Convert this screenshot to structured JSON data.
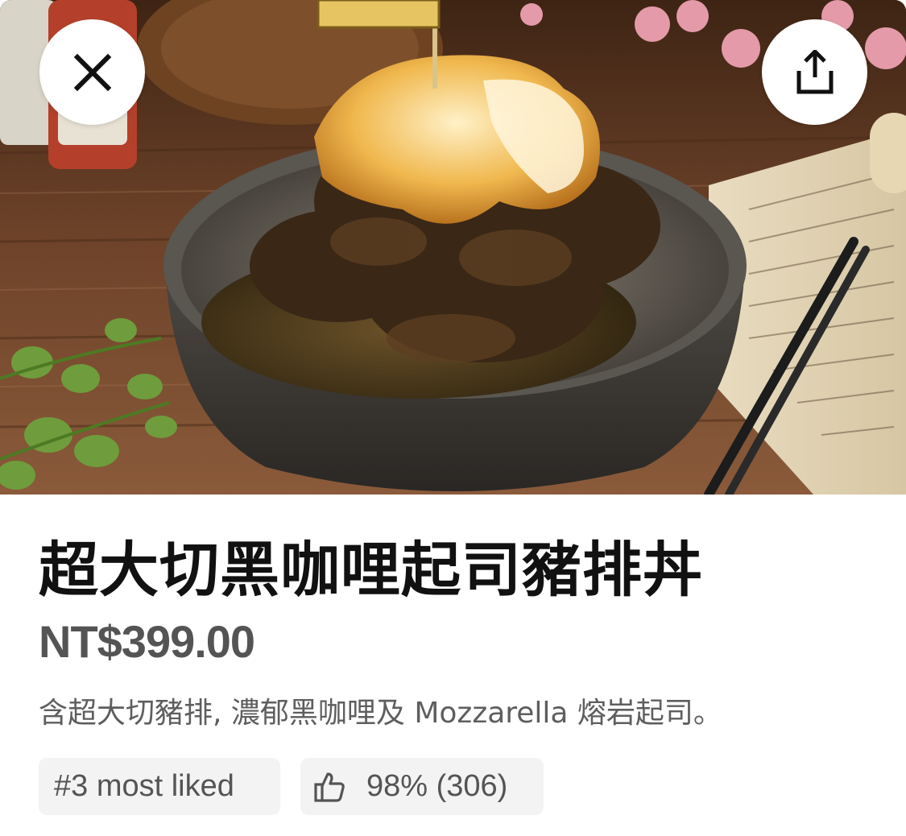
{
  "item": {
    "title": "超大切黑咖哩起司豬排丼",
    "price": "NT$399.00",
    "description": "含超大切豬排, 濃郁黑咖哩及 Mozzarella 熔岩起司。"
  },
  "badges": {
    "rank_label": "#3 most liked",
    "rating_label": "98% (306)"
  },
  "icons": {
    "close": "close-icon",
    "share": "share-icon",
    "thumbs_up": "thumbs-up-icon"
  },
  "colors": {
    "title": "#111111",
    "price": "#545454",
    "description": "#5e5e5e",
    "chip_background": "#f3f3f3"
  }
}
